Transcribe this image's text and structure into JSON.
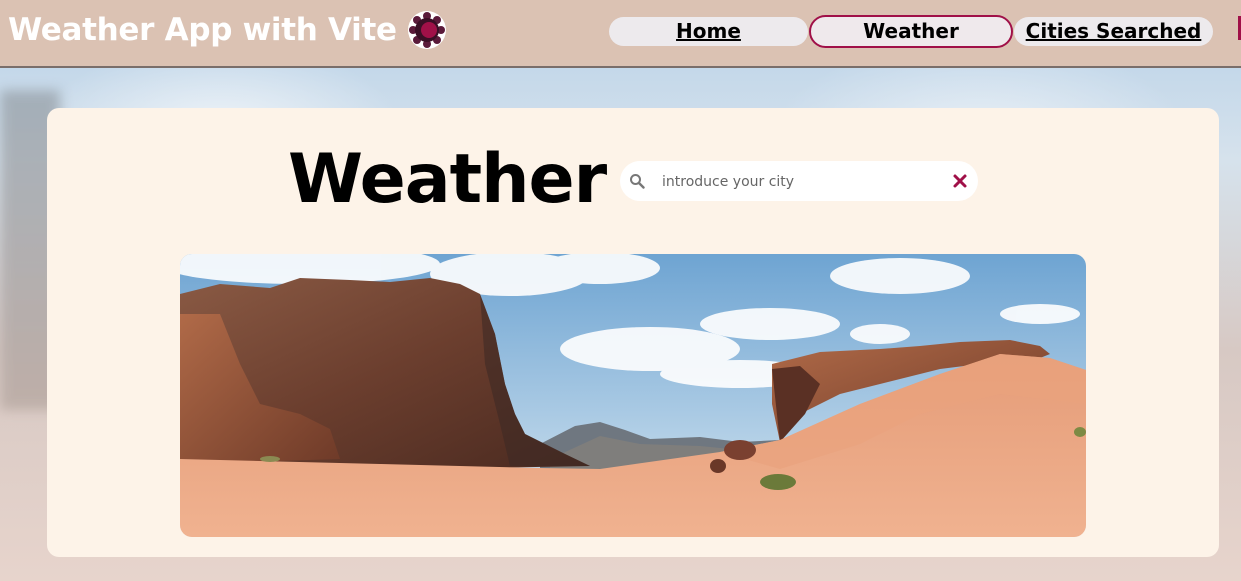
{
  "header": {
    "brand_title": "Weather App with Vite",
    "logo_icon": "vite-flower-logo-icon",
    "nav": [
      {
        "label": "Home",
        "active": false
      },
      {
        "label": "Weather",
        "active": true
      },
      {
        "label": "Cities Searched",
        "active": false
      }
    ]
  },
  "main": {
    "title": "Weather",
    "search": {
      "placeholder": "introduce your city",
      "value": "",
      "search_icon": "search-icon",
      "clear_icon": "close-icon"
    },
    "hero_image": {
      "icon": "desert-landscape-photo"
    }
  },
  "colors": {
    "accent": "#a01048",
    "header_bg": "#dbc2b3",
    "card_bg": "#fdf3e8",
    "nav_pill": "#edeaed"
  }
}
